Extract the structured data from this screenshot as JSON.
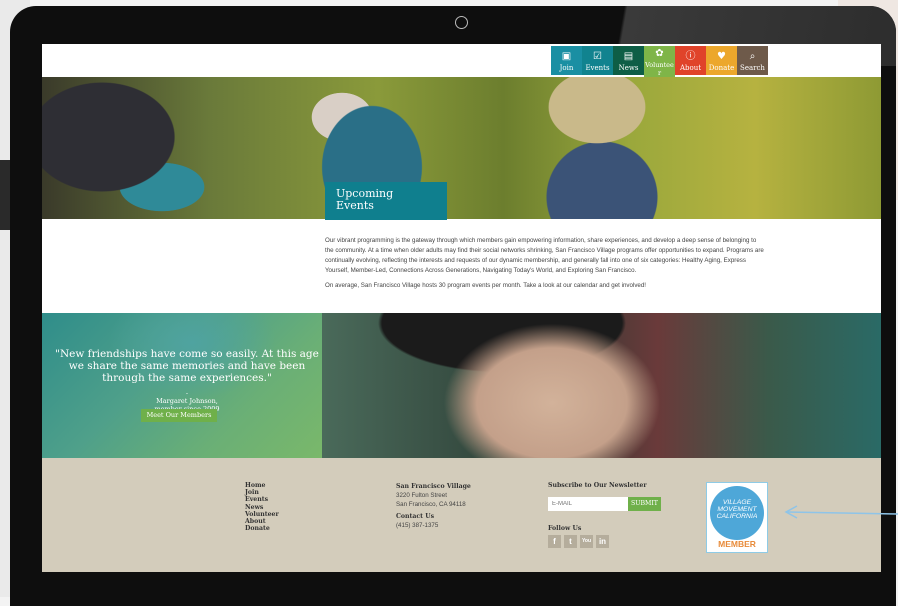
{
  "nav": {
    "items": [
      {
        "label": "Join",
        "icon": "id-card-icon",
        "color": "#1a8fa3"
      },
      {
        "label": "Events",
        "icon": "calendar-icon",
        "color": "#11838f"
      },
      {
        "label": "News",
        "icon": "newspaper-icon",
        "color": "#0e5e46"
      },
      {
        "label": "Volunteer",
        "icon": "hands-icon",
        "color": "#7fb548"
      },
      {
        "label": "About",
        "icon": "info-icon",
        "color": "#e0432a"
      },
      {
        "label": "Donate",
        "icon": "gift-icon",
        "color": "#eca72c"
      },
      {
        "label": "Search",
        "icon": "search-icon",
        "color": "#6e5a4a"
      }
    ]
  },
  "hero": {
    "title_line1": "Upcoming",
    "title_line2": "Events"
  },
  "intro": {
    "paragraph1": "Our vibrant programming is the gateway through which members gain empowering information, share experiences, and develop a deep sense of belonging to the community. At a time when older adults may find their social networks shrinking, San Francisco Village programs offer opportunities to expand. Programs are continually evolving, reflecting the interests and requests of our dynamic membership, and generally fall into one of six categories: Healthy Aging, Express Yourself, Member-Led, Connections Across Generations, Navigating Today's World, and Exploring San Francisco.",
    "paragraph2": "On average, San Francisco Village hosts 30 program events per month. Take a look at our calendar and get involved!"
  },
  "testimonial": {
    "quote": "\"New friendships have come so easily. At this age we share the same memories and have been through the same experiences.\"",
    "dash": "-",
    "name": "Margaret Johnson,",
    "since": "member since 2009",
    "button": "Meet Our Members"
  },
  "footer": {
    "links": [
      "Home",
      "Join",
      "Events",
      "News",
      "Volunteer",
      "About",
      "Donate"
    ],
    "org_name": "San Francisco Village",
    "address1": "3220 Fulton Street",
    "address2": "San Francisco, CA 94118",
    "contact_heading": "Contact Us",
    "phone": "(415) 387-1375",
    "newsletter_heading": "Subscribe to Our Newsletter",
    "email_placeholder": "E-MAIL",
    "submit": "SUBMIT",
    "follow_heading": "Follow Us",
    "socials": [
      {
        "label": "f",
        "icon": "facebook-icon"
      },
      {
        "label": "t",
        "icon": "twitter-icon"
      },
      {
        "label": "You",
        "icon": "youtube-icon"
      },
      {
        "label": "in",
        "icon": "linkedin-icon"
      }
    ],
    "badge_text": "VILLAGE MOVEMENT CALIFORNIA",
    "badge_member": "MEMBER"
  }
}
